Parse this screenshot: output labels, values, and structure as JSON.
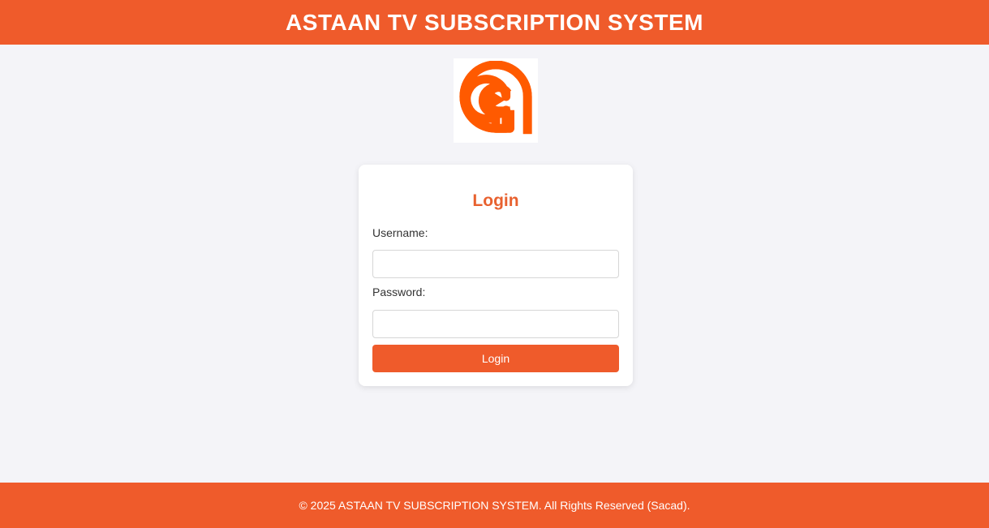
{
  "header": {
    "title": "ASTAAN TV SUBSCRIPTION SYSTEM"
  },
  "logo": {
    "icon": "astaan-logo-icon",
    "brand_color": "#ff5a00"
  },
  "login_form": {
    "title": "Login",
    "username_label": "Username:",
    "username_value": "",
    "password_label": "Password:",
    "password_value": "",
    "submit_label": "Login"
  },
  "footer": {
    "text": "© 2025 ASTAAN TV SUBSCRIPTION SYSTEM. All Rights Reserved (Sacad)."
  },
  "colors": {
    "accent": "#ef5b2b",
    "background": "#f4f4f8",
    "card": "#ffffff"
  }
}
